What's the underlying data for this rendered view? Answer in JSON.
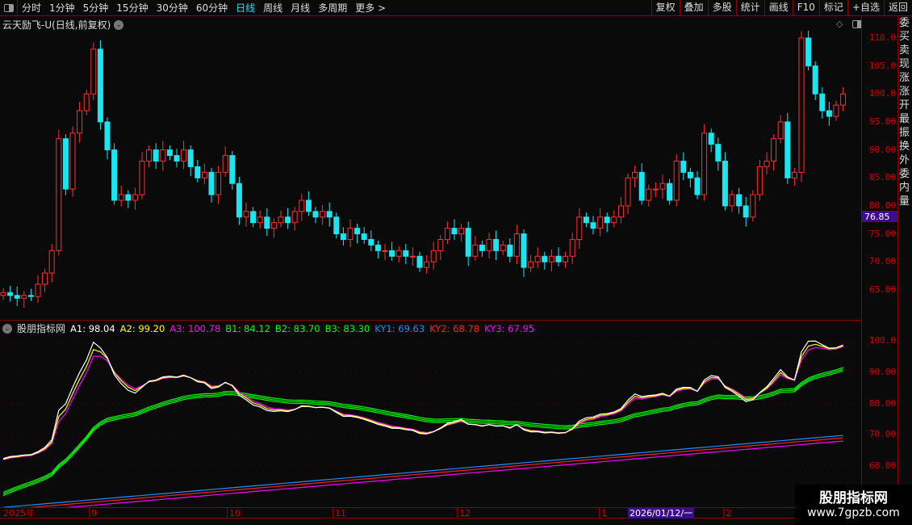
{
  "topbar": {
    "periods": [
      "分时",
      "1分钟",
      "5分钟",
      "15分钟",
      "30分钟",
      "60分钟",
      "日线",
      "周线",
      "月线",
      "多周期",
      "更多 >"
    ],
    "active": "日线",
    "tools": [
      "复权",
      "叠加",
      "多股",
      "统计",
      "画线",
      "F10",
      "标记",
      "+自选",
      "返回"
    ]
  },
  "title": "云天励飞-U(日线,前复权)",
  "price_axis": [
    "110.0",
    "105.0",
    "100.0",
    "95.00",
    "90.00",
    "85.00",
    "80.00",
    "75.00",
    "70.00",
    "65.00"
  ],
  "current_price": "76.85",
  "indicator": {
    "name": "股朋指标网",
    "legend": [
      {
        "label": "A1: 98.04",
        "color": "#ffffff"
      },
      {
        "label": "A2: 99.20",
        "color": "#ffff00"
      },
      {
        "label": "A3: 100.78",
        "color": "#ff00ff"
      },
      {
        "label": "B1: 84.12",
        "color": "#00ff00"
      },
      {
        "label": "B2: 83.70",
        "color": "#00ff00"
      },
      {
        "label": "B3: 83.30",
        "color": "#00ff00"
      },
      {
        "label": "KY1: 69.63",
        "color": "#1e90ff"
      },
      {
        "label": "KY2: 68.78",
        "color": "#ff2020"
      },
      {
        "label": "KY3: 67.95",
        "color": "#ff00ff"
      }
    ],
    "axis": [
      "100.0",
      "90.00",
      "80.00",
      "70.00",
      "60.00"
    ]
  },
  "date_axis": [
    "2025年",
    "9",
    "10",
    "11",
    "12",
    "1",
    "2"
  ],
  "date_cursor": "2026/01/12/一",
  "side_strip": "委买卖现涨涨开最振换外委内量",
  "watermark": {
    "name": "股朋指标网",
    "url": "www.7gpzb.com"
  },
  "colors": {
    "up": "#ff3030",
    "down": "#19e6f0",
    "grid": "#8b0000"
  },
  "chart_data": {
    "type": "candlestick",
    "price_range": [
      61,
      112
    ],
    "closes": [
      64.5,
      64,
      63.5,
      64,
      63.8,
      66,
      68,
      72,
      92,
      83,
      93,
      97,
      100,
      108,
      95,
      90,
      81,
      82,
      81,
      82,
      88,
      90,
      88,
      90,
      89,
      88,
      90,
      87,
      85,
      86,
      82,
      86,
      89,
      84,
      78,
      79,
      77,
      78,
      76,
      77,
      78,
      77,
      79,
      81,
      79,
      78,
      79,
      78,
      75,
      74,
      76,
      75,
      74,
      73,
      72,
      72,
      71,
      72,
      71,
      71,
      69,
      70,
      72,
      74,
      76,
      75,
      76,
      71,
      73,
      72,
      74,
      72,
      73,
      71,
      75,
      69,
      70,
      71,
      70,
      71,
      70,
      71,
      74,
      78,
      77,
      76,
      78,
      77,
      78,
      80,
      85,
      86,
      81,
      83,
      83,
      84,
      81,
      88,
      86,
      85,
      82,
      93,
      91,
      88,
      80,
      82,
      80,
      78,
      82,
      87,
      88,
      92,
      95,
      85,
      86,
      110,
      105,
      100,
      97,
      96,
      98,
      100
    ]
  }
}
